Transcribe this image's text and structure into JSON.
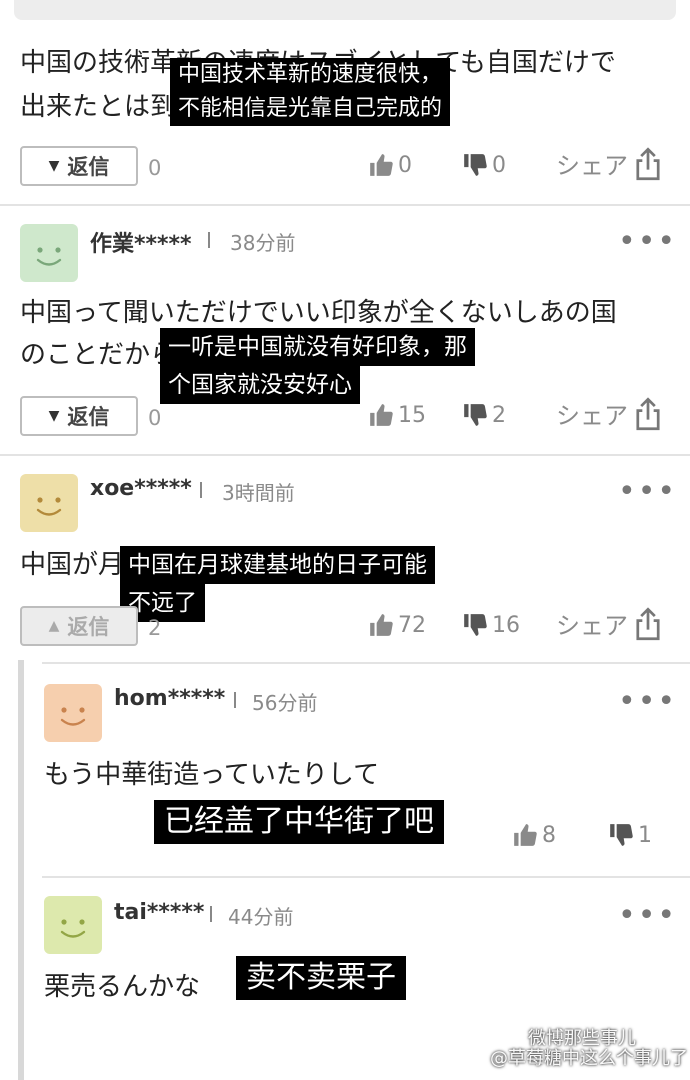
{
  "comments": [
    {
      "body_lines": [
        "中国の技術革新の速度はスゴイとしても自国だけで",
        "出来たとは到底思えない"
      ],
      "caption_lines": [
        "中国技术革新的速度很快，",
        "不能相信是光靠自己完成的"
      ],
      "reply_label": "返信",
      "reply_count": "0",
      "likes": "0",
      "dislikes": "0",
      "share_label": "シェア"
    },
    {
      "avatar_color": "#cfe8cc",
      "username": "作業*****",
      "time": "38分前",
      "body_lines": [
        "中国って聞いただけでいい印象が全くないしあの国",
        "のことだから…怪しい"
      ],
      "caption_lines": [
        "一听是中国就没有好印象，那",
        "个国家就没安好心"
      ],
      "reply_label": "返信",
      "reply_count": "0",
      "likes": "15",
      "dislikes": "2",
      "share_label": "シェア"
    },
    {
      "avatar_color": "#eedfa8",
      "username": "xoe*****",
      "time": "3時間前",
      "body_lines": [
        "中国が月に基地を作る日も近いかも"
      ],
      "caption_lines": [
        "中国在月球建基地的日子可能",
        "不远了"
      ],
      "reply_label": "返信",
      "reply_count": "2",
      "likes": "72",
      "dislikes": "16",
      "share_label": "シェア"
    }
  ],
  "replies": [
    {
      "avatar_color": "#f6cfae",
      "username": "hom*****",
      "time": "56分前",
      "body": "もう中華街造っていたりして",
      "caption": "已经盖了中华街了吧",
      "likes": "8",
      "dislikes": "1"
    },
    {
      "avatar_color": "#dde9ad",
      "username": "tai*****",
      "time": "44分前",
      "body": "栗売るんかな",
      "caption": "卖不卖栗子"
    }
  ],
  "more_label": "•••",
  "watermark": {
    "line1": "微博那些事儿",
    "line2": "@草莓糖中这么个事儿了"
  },
  "colors": {
    "caption_bg": "#000000",
    "meta_gray": "#8a8a8a",
    "divider": "#e3e3e3"
  }
}
